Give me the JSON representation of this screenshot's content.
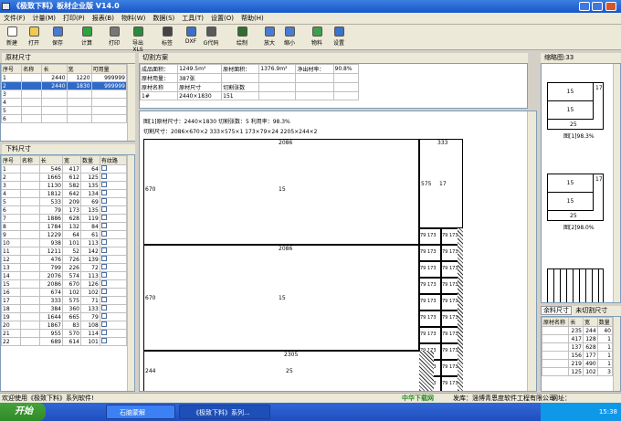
{
  "window": {
    "title": "《极致下料》板材企业版 V14.0"
  },
  "menu": [
    "文件(F)",
    "计量(M)",
    "打印(P)",
    "报表(B)",
    "物料(W)",
    "数据(S)",
    "工具(T)",
    "设置(O)",
    "帮助(H)"
  ],
  "toolbar": [
    {
      "icon": "new-icon",
      "label": "新建"
    },
    {
      "icon": "open-icon",
      "label": "打开"
    },
    {
      "icon": "save-icon",
      "label": "保存"
    },
    {
      "icon": "play-icon",
      "label": "计算"
    },
    {
      "icon": "print-icon",
      "label": "打印"
    },
    {
      "icon": "excel-icon",
      "label": "导出XLS"
    },
    {
      "icon": "label-icon",
      "label": "标签"
    },
    {
      "icon": "dxf-icon",
      "label": "DXF"
    },
    {
      "icon": "gcode-icon",
      "label": "G代码"
    },
    {
      "icon": "draw-icon",
      "label": "绘制"
    },
    {
      "icon": "zoom-in-icon",
      "label": "放大"
    },
    {
      "icon": "zoom-out-icon",
      "label": "缩小"
    },
    {
      "icon": "material-icon",
      "label": "物料"
    },
    {
      "icon": "settings-icon",
      "label": "设置"
    }
  ],
  "raw": {
    "tab": "原材尺寸",
    "headers": [
      "序号",
      "名称",
      "长",
      "宽",
      "可用量"
    ],
    "rows": [
      [
        "1",
        "",
        "2440",
        "1220",
        "999999"
      ],
      [
        "2",
        "",
        "2440",
        "1830",
        "999999"
      ],
      [
        "3",
        "",
        "",
        "",
        ""
      ],
      [
        "4",
        "",
        "",
        "",
        ""
      ],
      [
        "5",
        "",
        "",
        "",
        ""
      ],
      [
        "6",
        "",
        "",
        "",
        ""
      ]
    ]
  },
  "parts": {
    "tab": "下料尺寸",
    "headers": [
      "序号",
      "名称",
      "长",
      "宽",
      "数量",
      "有纹路"
    ],
    "rows": [
      [
        "1",
        "",
        "546",
        "417",
        "64"
      ],
      [
        "2",
        "",
        "1665",
        "612",
        "125"
      ],
      [
        "3",
        "",
        "1130",
        "582",
        "135"
      ],
      [
        "4",
        "",
        "1812",
        "642",
        "134"
      ],
      [
        "5",
        "",
        "533",
        "209",
        "69"
      ],
      [
        "6",
        "",
        "79",
        "173",
        "135"
      ],
      [
        "7",
        "",
        "1886",
        "628",
        "119"
      ],
      [
        "8",
        "",
        "1784",
        "132",
        "84"
      ],
      [
        "9",
        "",
        "1229",
        "64",
        "61"
      ],
      [
        "10",
        "",
        "938",
        "101",
        "113"
      ],
      [
        "11",
        "",
        "1211",
        "52",
        "142"
      ],
      [
        "12",
        "",
        "476",
        "726",
        "139"
      ],
      [
        "13",
        "",
        "799",
        "226",
        "72"
      ],
      [
        "14",
        "",
        "2076",
        "574",
        "113"
      ],
      [
        "15",
        "",
        "2086",
        "670",
        "126"
      ],
      [
        "16",
        "",
        "674",
        "102",
        "102"
      ],
      [
        "17",
        "",
        "333",
        "575",
        "71"
      ],
      [
        "18",
        "",
        "384",
        "360",
        "133"
      ],
      [
        "19",
        "",
        "1644",
        "665",
        "79"
      ],
      [
        "20",
        "",
        "1867",
        "83",
        "108"
      ],
      [
        "21",
        "",
        "955",
        "570",
        "114"
      ],
      [
        "22",
        "",
        "689",
        "614",
        "101"
      ]
    ]
  },
  "plan": {
    "tab": "切割方案",
    "summary": [
      [
        "成品面积：",
        "1249.5m²",
        "原材面积：",
        "1376.9m²",
        "净出材率：",
        "90.8%"
      ],
      [
        "原材用量：",
        "387张",
        "",
        "",
        "",
        ""
      ],
      [
        "原材名称",
        "原材尺寸",
        "切割张数",
        "",
        "",
        ""
      ],
      [
        "1#",
        "2440×1830",
        "151",
        "",
        "",
        ""
      ]
    ]
  },
  "drawing": {
    "header1": "图[1]原材尺寸：2440×1830  切割张数：5  利用率：98.3%",
    "header2": "切割尺寸：2086×670×2  333×575×1  173×79×24  2205×244×2",
    "label_670": "670",
    "label_2086": "2086",
    "label_15": "15",
    "label_333": "333",
    "label_575": "575",
    "label_17": "17",
    "label_79": "79",
    "label_173": "173",
    "label_2305": "2305",
    "label_244": "244",
    "label_25": "25"
  },
  "thumbs": {
    "tab": "缩略图:33",
    "items": [
      {
        "caption": "图[1]98.3%",
        "n15": "15",
        "n17": "17",
        "n25": "25"
      },
      {
        "caption": "图[2]98.0%",
        "n15": "15",
        "n17": "17",
        "n25": "25"
      }
    ]
  },
  "leftover": {
    "tabs": [
      "余料尺寸",
      "未切割尺寸"
    ],
    "headers": [
      "原材名称",
      "长",
      "宽",
      "数量"
    ],
    "rows": [
      [
        "",
        "235",
        "244",
        "40"
      ],
      [
        "",
        "417",
        "128",
        "1"
      ],
      [
        "",
        "137",
        "628",
        "1"
      ],
      [
        "",
        "156",
        "177",
        "1"
      ],
      [
        "",
        "219",
        "490",
        "1"
      ],
      [
        "",
        "125",
        "102",
        "3"
      ]
    ]
  },
  "status": {
    "left": "欢迎使用《极致下料》系列软件!",
    "brand": "中华下载网",
    "company": "发库：淄博青恩度软件工程有限公司",
    "url": "网址：www.jzxlsoft.com"
  },
  "taskbar": {
    "start": "开始",
    "tasks": [
      "石脑蒙解",
      "《极致下料》系列..."
    ],
    "clock": "15:38"
  }
}
